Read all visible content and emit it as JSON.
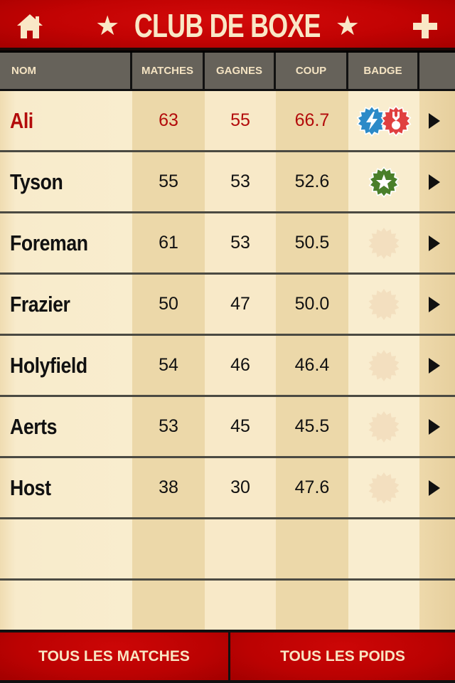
{
  "header": {
    "title": "CLUB DE BOXE",
    "star_glyph": "★",
    "home_icon": "home-icon",
    "add_icon": "plus-icon"
  },
  "columns": {
    "nom": "NOM",
    "matches": "MATCHES",
    "gagnes": "GAGNES",
    "coup": "COUP",
    "badge": "BADGE"
  },
  "rows": [
    {
      "nom": "Ali",
      "matches": "63",
      "gagnes": "55",
      "coup": "66.7",
      "highlight": true,
      "badges": [
        "lightning-badge",
        "medal-badge"
      ]
    },
    {
      "nom": "Tyson",
      "matches": "55",
      "gagnes": "53",
      "coup": "52.6",
      "highlight": false,
      "badges": [
        "star-badge"
      ]
    },
    {
      "nom": "Foreman",
      "matches": "61",
      "gagnes": "53",
      "coup": "50.5",
      "highlight": false,
      "badges": []
    },
    {
      "nom": "Frazier",
      "matches": "50",
      "gagnes": "47",
      "coup": "50.0",
      "highlight": false,
      "badges": []
    },
    {
      "nom": "Holyfield",
      "matches": "54",
      "gagnes": "46",
      "coup": "46.4",
      "highlight": false,
      "badges": []
    },
    {
      "nom": "Aerts",
      "matches": "53",
      "gagnes": "45",
      "coup": "45.5",
      "highlight": false,
      "badges": []
    },
    {
      "nom": "Host",
      "matches": "38",
      "gagnes": "30",
      "coup": "47.6",
      "highlight": false,
      "badges": []
    }
  ],
  "empty_rows": 2,
  "colors": {
    "brand_red": "#c20303",
    "highlight_text": "#b30b0b",
    "header_gray": "#66625a",
    "cream_text": "#f9e7c6",
    "badge_blue": "#2c8ac8",
    "badge_red": "#e04040",
    "badge_green": "#4a7f2a",
    "badge_placeholder": "#f3dfbf"
  },
  "footer": {
    "all_matches": "TOUS LES MATCHES",
    "all_weights": "TOUS LES POIDS"
  }
}
